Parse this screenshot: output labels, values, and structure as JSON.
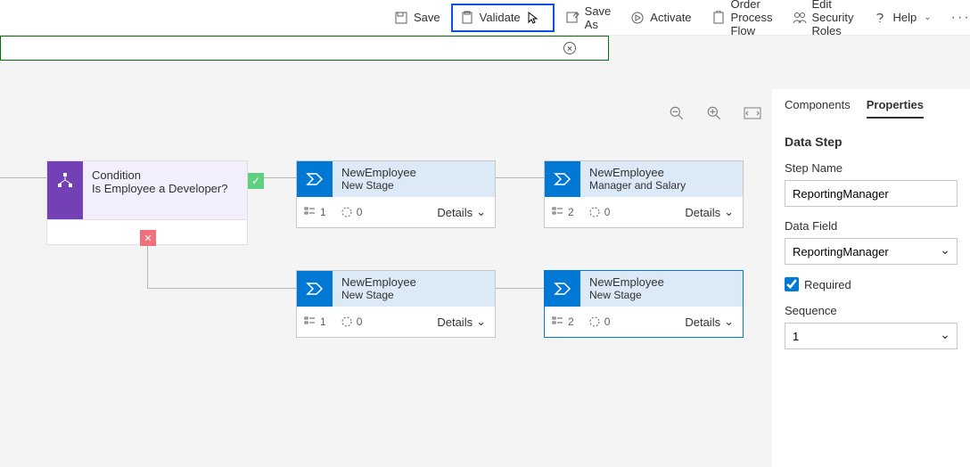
{
  "toolbar": {
    "save": "Save",
    "validate": "Validate",
    "saveAs": "Save As",
    "activate": "Activate",
    "orderFlow": "Order Process Flow",
    "editRoles": "Edit Security Roles",
    "help": "Help"
  },
  "condition": {
    "title": "Condition",
    "subtitle": "Is Employee a Developer?"
  },
  "stages": {
    "s1": {
      "line1": "NewEmployee",
      "line2": "New Stage",
      "count": "1",
      "sub": "0",
      "details": "Details"
    },
    "s2": {
      "line1": "NewEmployee",
      "line2": "Manager and Salary",
      "count": "2",
      "sub": "0",
      "details": "Details"
    },
    "s3": {
      "line1": "NewEmployee",
      "line2": "New Stage",
      "count": "1",
      "sub": "0",
      "details": "Details"
    },
    "s4": {
      "line1": "NewEmployee",
      "line2": "New Stage",
      "count": "2",
      "sub": "0",
      "details": "Details"
    }
  },
  "panel": {
    "tabComponents": "Components",
    "tabProperties": "Properties",
    "sectionTitle": "Data Step",
    "stepNameLabel": "Step Name",
    "stepNameValue": "ReportingManager",
    "dataFieldLabel": "Data Field",
    "dataFieldValue": "ReportingManager",
    "requiredLabel": "Required",
    "sequenceLabel": "Sequence",
    "sequenceValue": "1"
  }
}
